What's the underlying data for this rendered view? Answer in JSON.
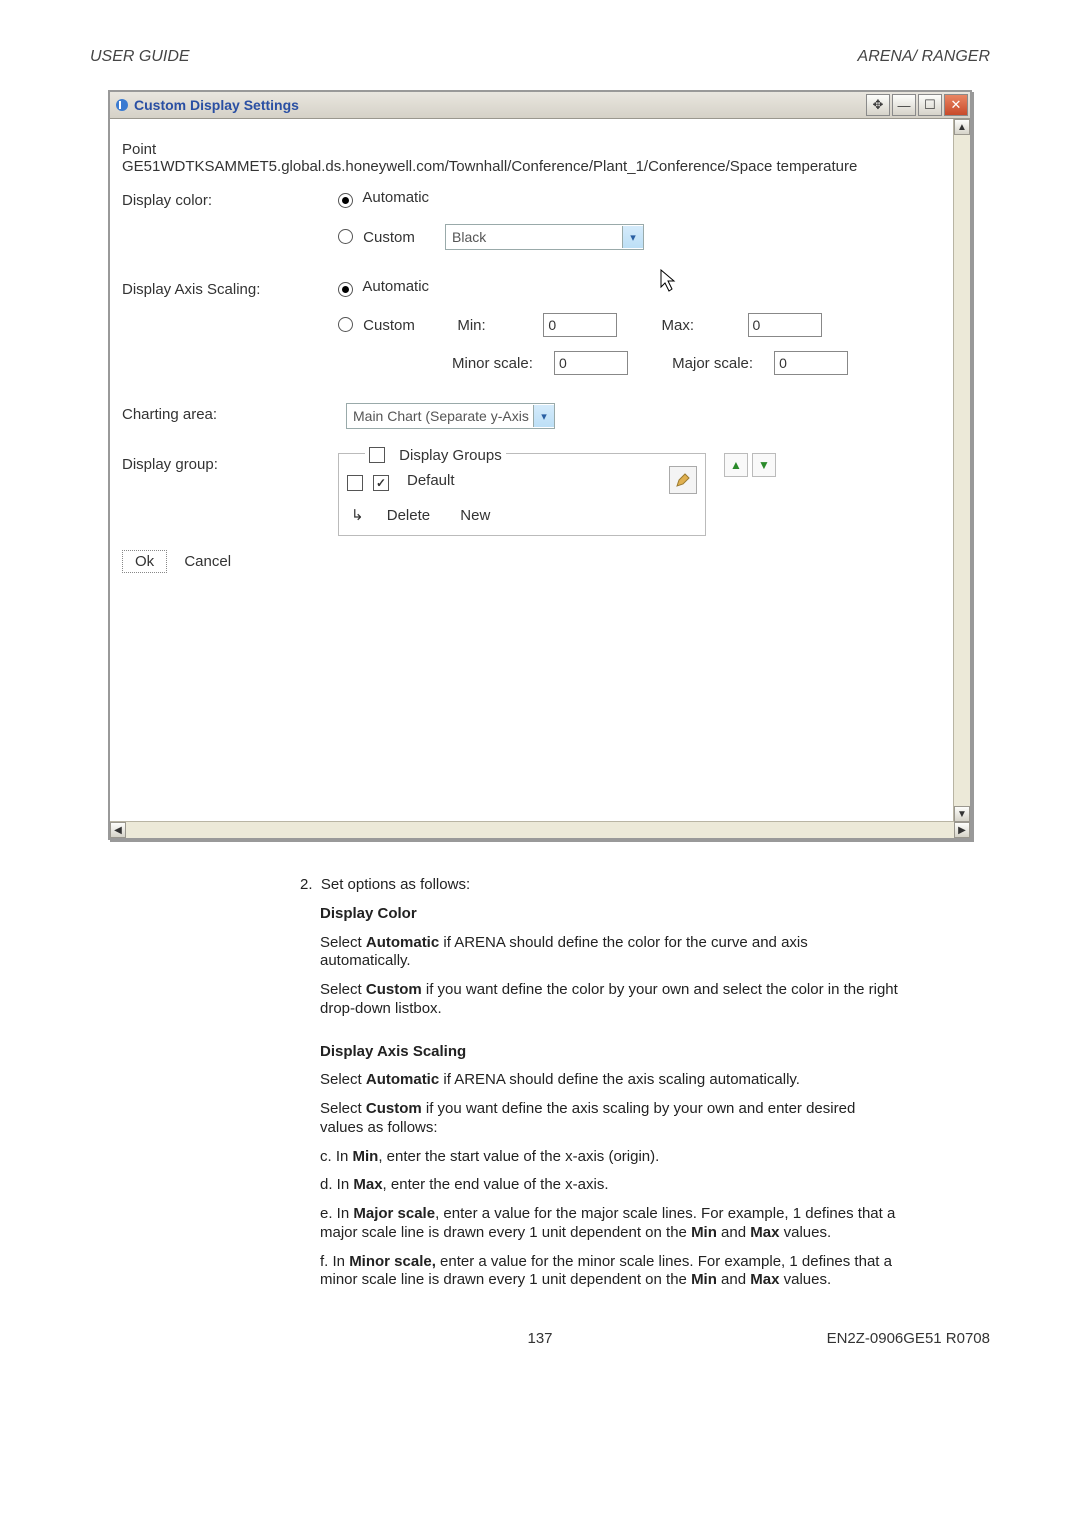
{
  "header": {
    "left": "USER GUIDE",
    "right": "ARENA/ RANGER"
  },
  "window": {
    "title": "Custom Display Settings",
    "point_label": "Point",
    "point_path": "GE51WDTKSAMMET5.global.ds.honeywell.com/Townhall/Conference/Plant_1/Conference/Space temperature",
    "rows": {
      "display_color": {
        "label": "Display color:",
        "auto": "Automatic",
        "custom": "Custom",
        "color_dd": "Black"
      },
      "axis_scaling": {
        "label": "Display Axis Scaling:",
        "auto": "Automatic",
        "custom": "Custom",
        "min_lbl": "Min:",
        "min_val": "0",
        "max_lbl": "Max:",
        "max_val": "0",
        "minor_lbl": "Minor scale:",
        "minor_val": "0",
        "major_lbl": "Major scale:",
        "major_val": "0"
      },
      "charting": {
        "label": "Charting area:",
        "dd": "Main Chart (Separate y-Axis"
      },
      "group": {
        "label": "Display group:",
        "legend": "Display Groups",
        "default_label": "Default",
        "delete": "Delete",
        "new": "New"
      }
    },
    "buttons": {
      "ok": "Ok",
      "cancel": "Cancel"
    }
  },
  "doc": {
    "step2_intro": "Set options as follows:",
    "h_color": "Display Color",
    "color_p1_a": "Select ",
    "color_p1_b": "Automatic",
    "color_p1_c": " if ARENA should define the color for the curve and axis automatically.",
    "color_p2_a": "Select ",
    "color_p2_b": "Custom",
    "color_p2_c": " if you want define the color by your own and select the color in the right drop-down listbox.",
    "h_axis": "Display Axis Scaling",
    "axis_p1_a": "Select ",
    "axis_p1_b": "Automatic",
    "axis_p1_c": " if ARENA should define the axis scaling automatically.",
    "axis_p2_a": "Select ",
    "axis_p2_b": "Custom",
    "axis_p2_c": " if you want define the axis scaling by your own and enter desired values as follows:",
    "li_c_a": "c.  In ",
    "li_c_b": "Min",
    "li_c_c": ", enter the start value of the x-axis (origin).",
    "li_d_a": "d.  In ",
    "li_d_b": "Max",
    "li_d_c": ", enter the end value of the x-axis.",
    "li_e_a": "e.  In ",
    "li_e_b": "Major scale",
    "li_e_c": ", enter a value for the major scale lines. For example, 1 defines that a major scale line is drawn every 1 unit dependent on the ",
    "li_e_d": "Min",
    "li_e_e": " and ",
    "li_e_f": "Max",
    "li_e_g": " values.",
    "li_f_a": "f.  In ",
    "li_f_b": "Minor scale,",
    "li_f_c": " enter a value for the minor scale lines. For example, 1 defines that a minor scale line is drawn every 1 unit dependent on the ",
    "li_f_d": "Min",
    "li_f_e": " and ",
    "li_f_f": "Max",
    "li_f_g": " values."
  },
  "footer": {
    "page": "137",
    "docnum": "EN2Z-0906GE51 R0708"
  }
}
